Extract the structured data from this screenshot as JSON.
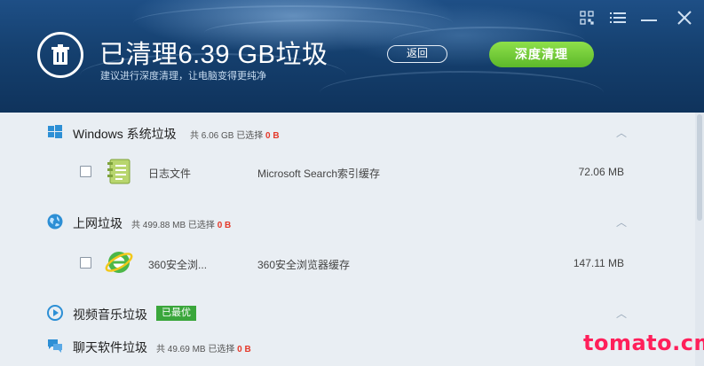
{
  "header": {
    "title": "已清理6.39 GB垃圾",
    "subtitle": "建议进行深度清理，让电脑变得更纯净",
    "back_label": "返回",
    "deep_clean_label": "深度清理",
    "window_controls": [
      "qr-code-icon",
      "menu-icon",
      "minimize-icon",
      "close-icon"
    ]
  },
  "categories": {
    "windows": {
      "title": "Windows 系统垃圾",
      "meta_total": "共 6.06 GB 已选择",
      "meta_selected": "0 B",
      "icon": "windows-logo-icon",
      "items": [
        {
          "name": "日志文件",
          "desc": "Microsoft Search索引缓存",
          "size": "72.06 MB",
          "icon": "log-file-icon",
          "checked": false
        }
      ]
    },
    "internet": {
      "title": "上网垃圾",
      "meta_total": "共 499.88 MB 已选择",
      "meta_selected": "0 B",
      "icon": "globe-icon",
      "items": [
        {
          "name": "360安全浏...",
          "desc": "360安全浏览器缓存",
          "size": "147.11 MB",
          "icon": "browser-360-icon",
          "checked": false
        }
      ]
    },
    "media": {
      "title": "视频音乐垃圾",
      "badge": "已最优",
      "icon": "play-icon"
    },
    "chat": {
      "title": "聊天软件垃圾",
      "meta_total": "共 49.69 MB 已选择",
      "meta_selected": "0 B",
      "icon": "chat-icon"
    }
  },
  "watermark": "tomato.cm",
  "colors": {
    "header_bg": "#15406f",
    "accent_green": "#5cb82a",
    "selected_red": "#e4392a",
    "badge_green": "#3aa63b",
    "watermark_pink": "#ff1f5a"
  }
}
